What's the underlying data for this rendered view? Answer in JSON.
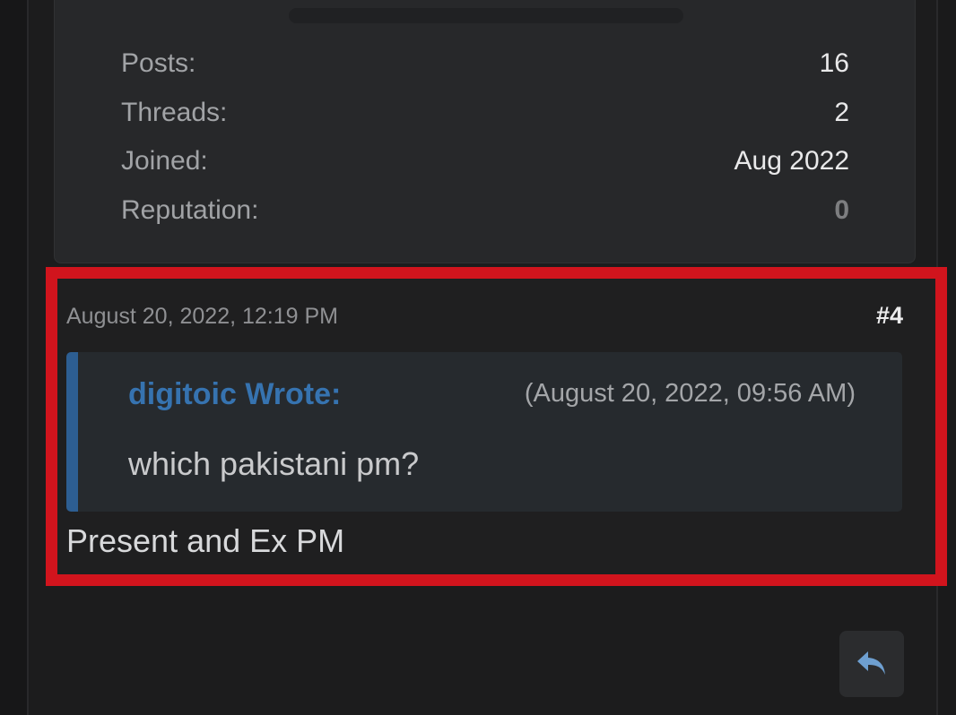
{
  "user_stats": [
    {
      "label": "Posts:",
      "value": "16"
    },
    {
      "label": "Threads:",
      "value": "2"
    },
    {
      "label": "Joined:",
      "value": "Aug 2022"
    },
    {
      "label": "Reputation:",
      "value": "0"
    }
  ],
  "post": {
    "date": "August 20, 2022, 12:19 PM",
    "number": "#4",
    "quote": {
      "author": "digitoic Wrote:",
      "time": "(August 20, 2022, 09:56 AM)",
      "text": "which pakistani pm?"
    },
    "body": "Present and Ex PM"
  },
  "actions": {
    "reply_icon": "reply-icon"
  },
  "colors": {
    "highlight_border": "#d1141d",
    "quote_accent": "#2d5e92",
    "quote_author": "#3673b0",
    "reply_icon": "#6e9fd0"
  }
}
